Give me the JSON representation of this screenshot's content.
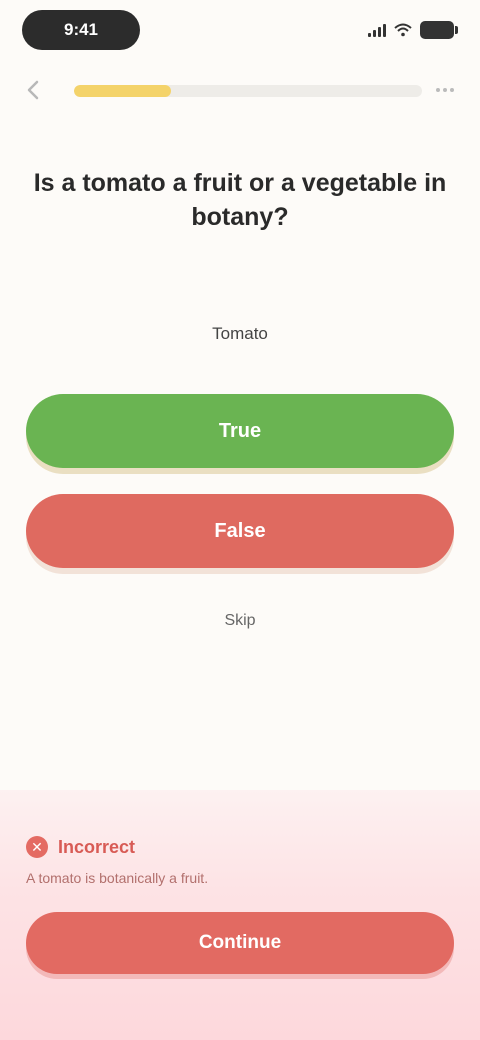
{
  "status_bar": {
    "time": "9:41"
  },
  "progress": {
    "fraction": 0.28
  },
  "question": {
    "text": "Is a tomato a fruit or a vegetable in botany?",
    "subject": "Tomato"
  },
  "answers": {
    "true_label": "True",
    "false_label": "False"
  },
  "skip_label": "Skip",
  "feedback": {
    "title": "Incorrect",
    "detail": "A tomato is botanically a fruit.",
    "continue_label": "Continue"
  },
  "colors": {
    "correct": "#6ab452",
    "incorrect": "#df6a60",
    "progress": "#f4d36a"
  },
  "icons": {
    "back": "back-arrow-icon",
    "more": "more-icon",
    "feedback": "x-circle-icon"
  }
}
